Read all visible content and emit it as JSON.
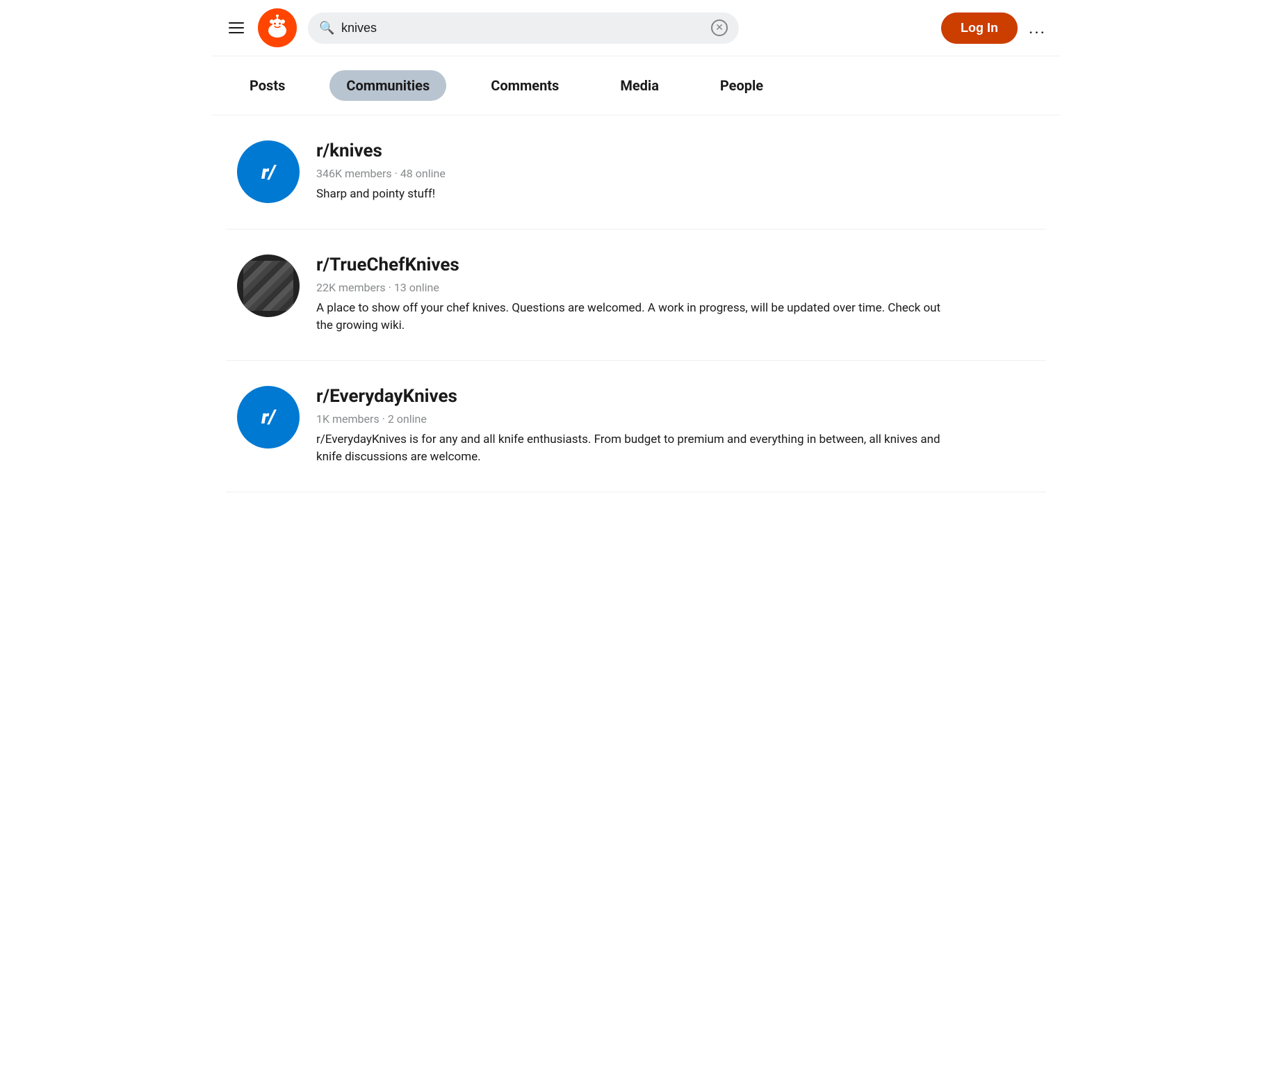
{
  "header": {
    "hamburger_label": "Menu",
    "logo_text": "🤖",
    "search_value": "knives",
    "search_placeholder": "Search Reddit",
    "login_label": "Log In",
    "more_label": "..."
  },
  "tabs": [
    {
      "id": "posts",
      "label": "Posts",
      "active": false
    },
    {
      "id": "communities",
      "label": "Communities",
      "active": true
    },
    {
      "id": "comments",
      "label": "Comments",
      "active": false
    },
    {
      "id": "media",
      "label": "Media",
      "active": false
    },
    {
      "id": "people",
      "label": "People",
      "active": false
    }
  ],
  "communities": [
    {
      "id": "knives",
      "name": "r/knives",
      "members": "346K members",
      "online": "48 online",
      "description": "Sharp and pointy stuff!",
      "avatar_type": "blue",
      "avatar_text": "r/"
    },
    {
      "id": "truechefknives",
      "name": "r/TrueChefKnives",
      "members": "22K members",
      "online": "13 online",
      "description": "A place to show off your chef knives. Questions are welcomed. A work in progress, will be updated over time. Check out the growing wiki.",
      "avatar_type": "chef",
      "avatar_text": ""
    },
    {
      "id": "everydayknives",
      "name": "r/EverydayKnives",
      "members": "1K members",
      "online": "2 online",
      "description": "r/EverydayKnives is for any and all knife enthusiasts. From budget to premium and everything in between, all knives and knife discussions are welcome.",
      "avatar_type": "blue",
      "avatar_text": "r/"
    }
  ],
  "colors": {
    "reddit_orange": "#ff4500",
    "active_tab_bg": "#b8c4cf",
    "blue_avatar": "#0079d3"
  }
}
